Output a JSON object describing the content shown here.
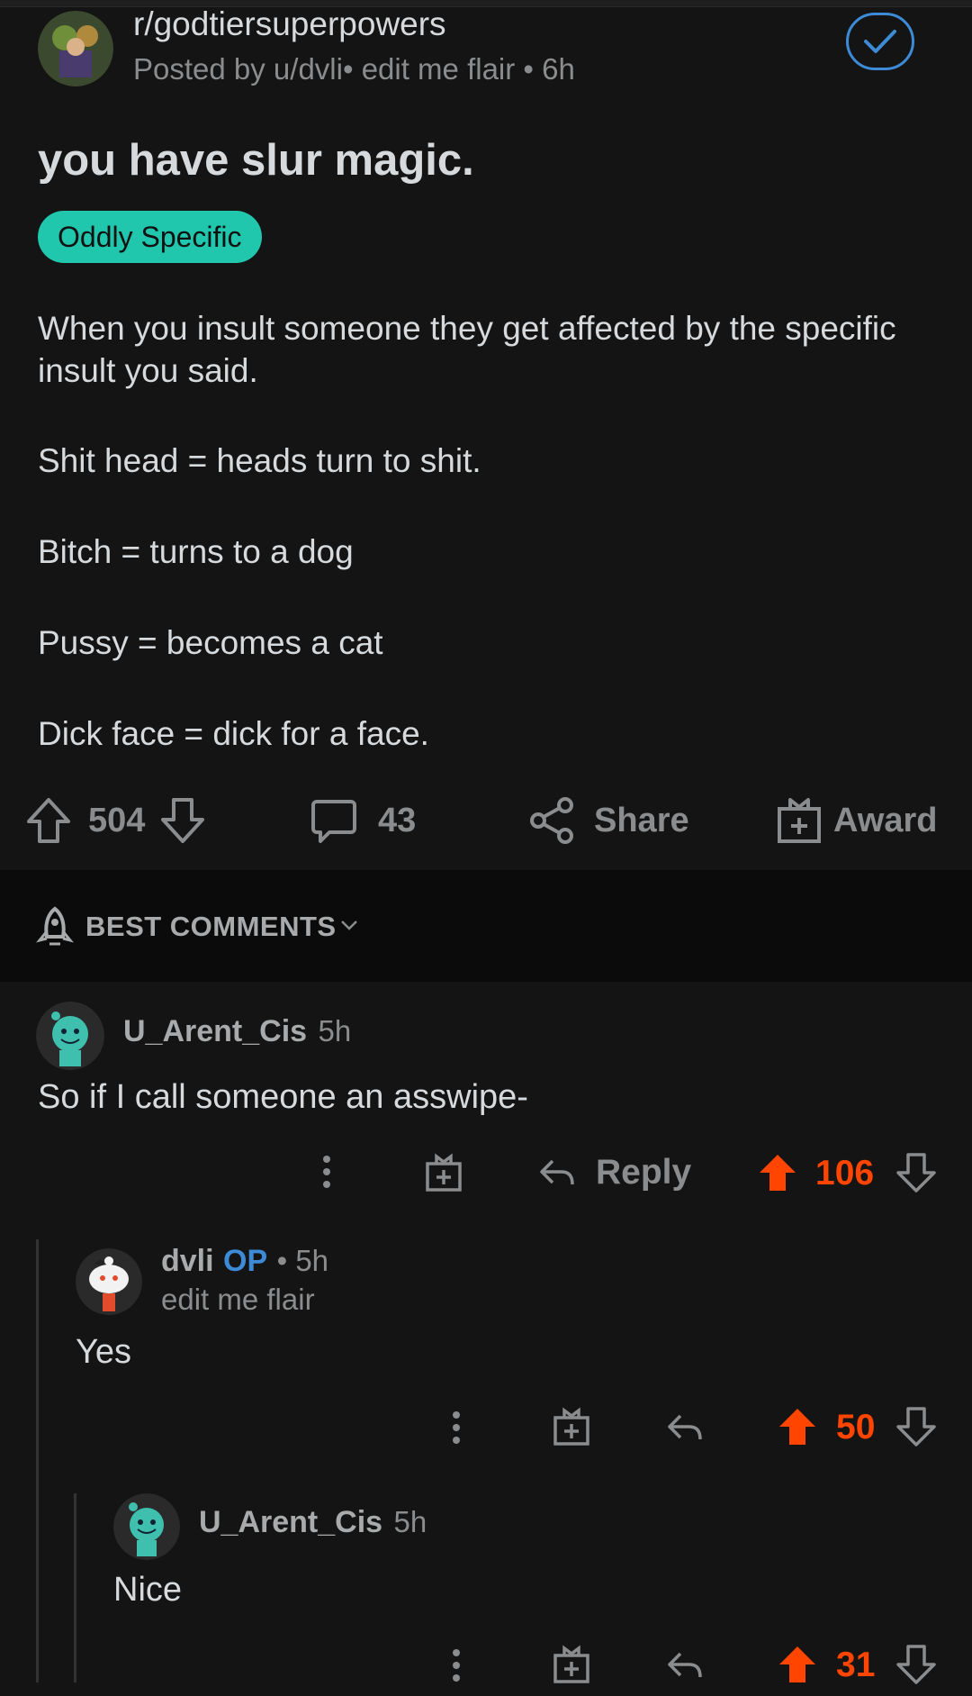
{
  "header": {
    "subreddit": "r/godtiersuperpowers",
    "meta": "Posted by u/dvli• edit me flair • 6h"
  },
  "post": {
    "title": "you have slur magic.",
    "flair": "Oddly Specific",
    "paragraphs": [
      "When you insult someone they get affected by the specific insult you said.",
      "Shit head = heads turn to shit.",
      "Bitch = turns to a dog",
      "Pussy = becomes a cat",
      "Dick face = dick for a face."
    ],
    "upvotes": "504",
    "comments": "43",
    "share_label": "Share",
    "award_label": "Award"
  },
  "sort": {
    "label": "BEST COMMENTS"
  },
  "comments": [
    {
      "user": "U_Arent_Cis",
      "time": "5h",
      "text": "So if I call someone an asswipe-",
      "reply_label": "Reply",
      "score": "106"
    },
    {
      "user": "dvli",
      "op": "OP",
      "time": "• 5h",
      "flair": "edit me flair",
      "text": "Yes",
      "score": "50"
    },
    {
      "user": "U_Arent_Cis",
      "time": "5h",
      "text": "Nice",
      "score": "31"
    }
  ],
  "colors": {
    "accent_upvote": "#ff4500",
    "flair_bg": "#20c7ad",
    "op_blue": "#3d8bd6",
    "background": "#141414"
  }
}
